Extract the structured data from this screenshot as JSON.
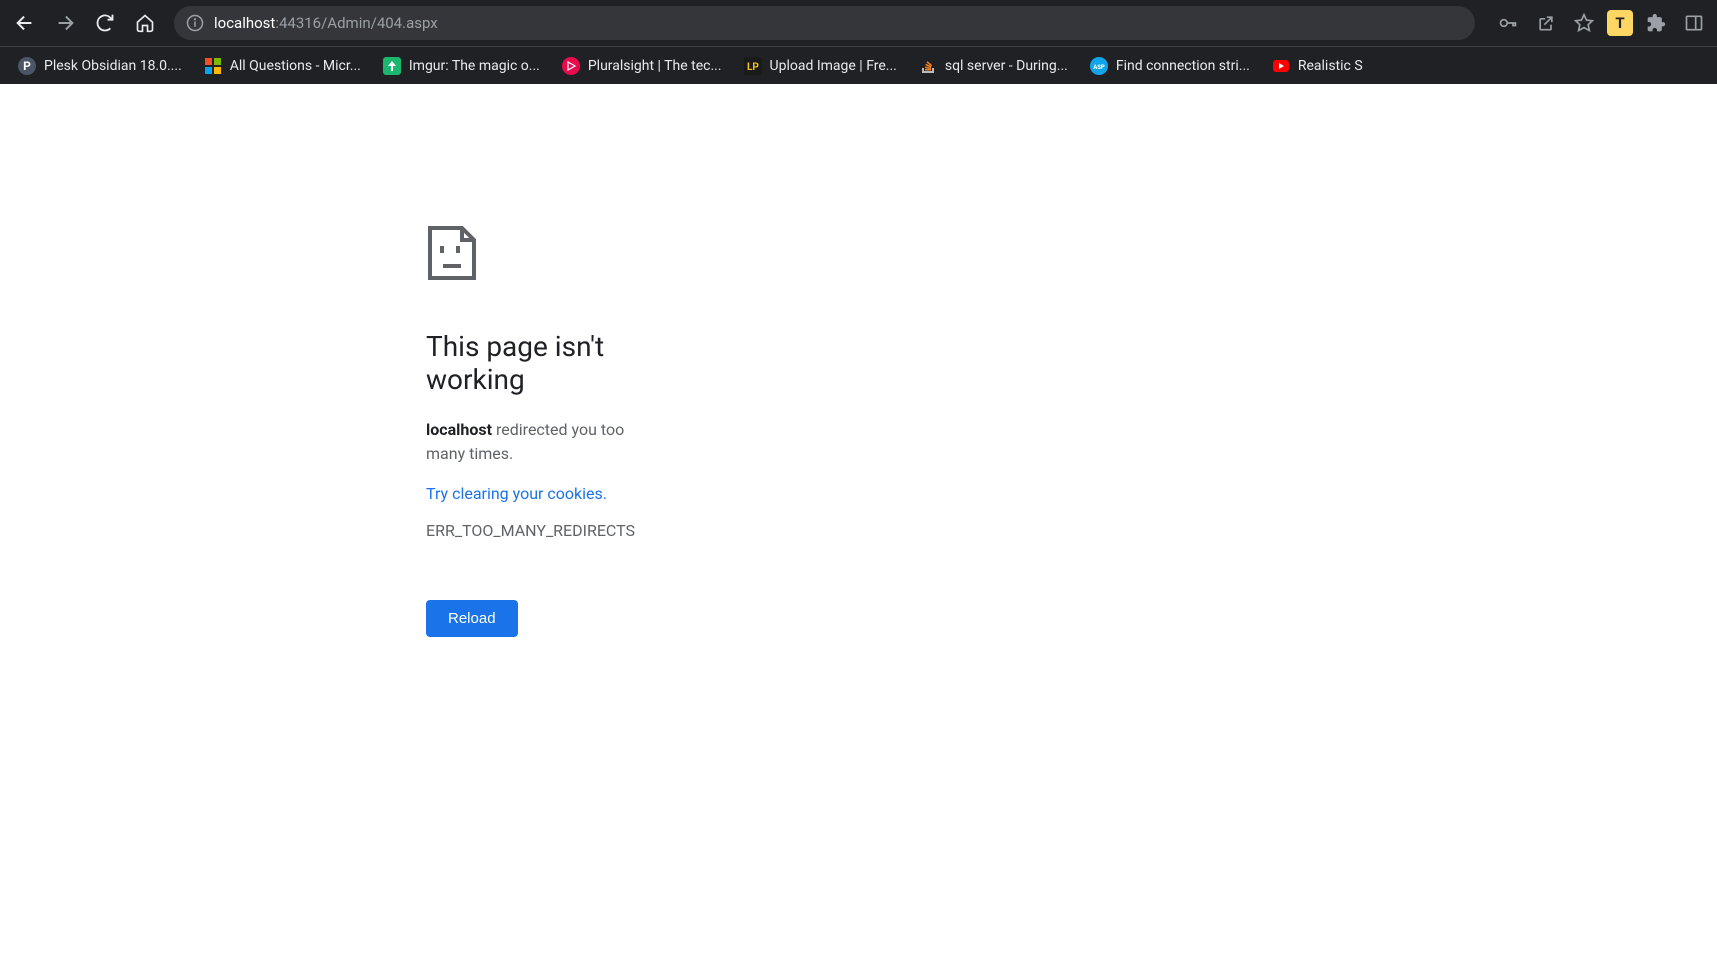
{
  "toolbar": {
    "url_host": "localhost",
    "url_path": ":44316/Admin/404.aspx",
    "profile_letter": "T"
  },
  "bookmarks": [
    {
      "label": "Plesk Obsidian 18.0...."
    },
    {
      "label": "All Questions - Micr..."
    },
    {
      "label": "Imgur: The magic o..."
    },
    {
      "label": "Pluralsight | The tec..."
    },
    {
      "label": "Upload Image | Fre..."
    },
    {
      "label": "sql server - During..."
    },
    {
      "label": "Find connection stri..."
    },
    {
      "label": "Realistic S"
    }
  ],
  "error": {
    "title": "This page isn't working",
    "host": "localhost",
    "desc_rest": " redirected you too many times.",
    "link_text": "Try clearing your cookies",
    "link_period": ".",
    "code": "ERR_TOO_MANY_REDIRECTS",
    "reload_label": "Reload"
  }
}
